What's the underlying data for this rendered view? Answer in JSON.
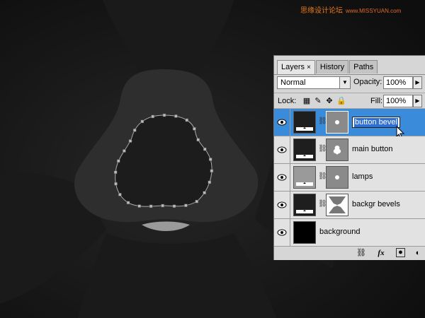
{
  "watermark": {
    "chinese": "思缘设计论坛",
    "site": "www.MISSYUAN.com"
  },
  "layers_panel": {
    "tabs": [
      {
        "label": "Layers"
      },
      {
        "label": "History"
      },
      {
        "label": "Paths"
      }
    ],
    "tab_close": "×",
    "blend_mode": "Normal",
    "opacity_label": "Opacity:",
    "opacity_value": "100%",
    "lock_label": "Lock:",
    "fill_label": "Fill:",
    "fill_value": "100%",
    "layers": [
      {
        "name": "button bevel",
        "selected": true,
        "editing": true
      },
      {
        "name": "main button",
        "selected": false
      },
      {
        "name": "lamps",
        "selected": false
      },
      {
        "name": "backgr bevels",
        "selected": false
      },
      {
        "name": "background",
        "selected": false
      }
    ],
    "footer_icons": [
      "link-icon",
      "fx-icon",
      "mask-icon",
      "adjustment-icon"
    ],
    "fx_label": "fx"
  },
  "colors": {
    "selected_row": "#3b8bdb",
    "panel_bg": "#d6d6d6",
    "row_bg": "#e2e2e2",
    "canvas_dark": "#161616",
    "shape": "#2e2e2e",
    "lamp": "#9a9a9a"
  }
}
